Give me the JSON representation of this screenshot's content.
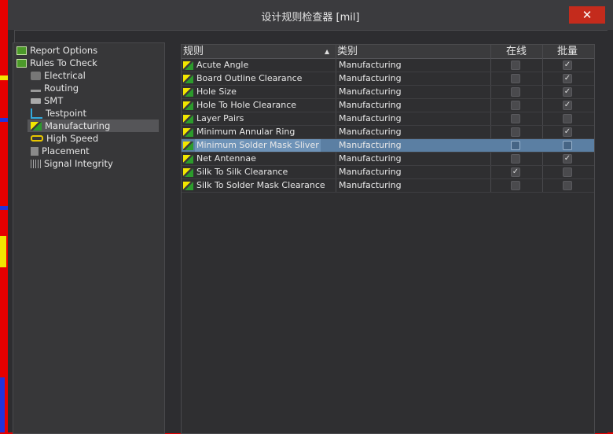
{
  "window": {
    "title": "设计规则检查器 [mil]",
    "close_glyph": "✕"
  },
  "tree": {
    "items": [
      {
        "label": "Report Options",
        "icon": "report-options-icon"
      },
      {
        "label": "Rules To Check",
        "icon": "rules-to-check-icon"
      },
      {
        "label": "Electrical",
        "icon": "electrical-icon"
      },
      {
        "label": "Routing",
        "icon": "routing-icon"
      },
      {
        "label": "SMT",
        "icon": "smt-icon"
      },
      {
        "label": "Testpoint",
        "icon": "testpoint-icon"
      },
      {
        "label": "Manufacturing",
        "icon": "manufacturing-icon",
        "selected": true
      },
      {
        "label": "High Speed",
        "icon": "high-speed-icon"
      },
      {
        "label": "Placement",
        "icon": "placement-icon"
      },
      {
        "label": "Signal Integrity",
        "icon": "signal-integrity-icon"
      }
    ]
  },
  "grid": {
    "columns": {
      "rule": "规则",
      "category": "类别",
      "online": "在线",
      "batch": "批量"
    },
    "sort_glyph": "▲",
    "check_glyph": "✓",
    "rows": [
      {
        "rule": "Acute Angle",
        "category": "Manufacturing",
        "online": false,
        "batch": true
      },
      {
        "rule": "Board Outline Clearance",
        "category": "Manufacturing",
        "online": false,
        "batch": true
      },
      {
        "rule": "Hole Size",
        "category": "Manufacturing",
        "online": false,
        "batch": true
      },
      {
        "rule": "Hole To Hole Clearance",
        "category": "Manufacturing",
        "online": false,
        "batch": true
      },
      {
        "rule": "Layer Pairs",
        "category": "Manufacturing",
        "online": false,
        "batch": false
      },
      {
        "rule": "Minimum Annular Ring",
        "category": "Manufacturing",
        "online": false,
        "batch": true
      },
      {
        "rule": "Minimum Solder Mask Sliver",
        "category": "Manufacturing",
        "online": false,
        "batch": false,
        "selected": true
      },
      {
        "rule": "Net Antennae",
        "category": "Manufacturing",
        "online": false,
        "batch": true
      },
      {
        "rule": "Silk To Silk Clearance",
        "category": "Manufacturing",
        "online": true,
        "batch": false
      },
      {
        "rule": "Silk To Solder Mask Clearance",
        "category": "Manufacturing",
        "online": false,
        "batch": false
      }
    ]
  },
  "colors": {
    "background": "#e60000",
    "dialog": "#2d2d30",
    "selection": "#5b7fa3",
    "close": "#c42b1c"
  }
}
